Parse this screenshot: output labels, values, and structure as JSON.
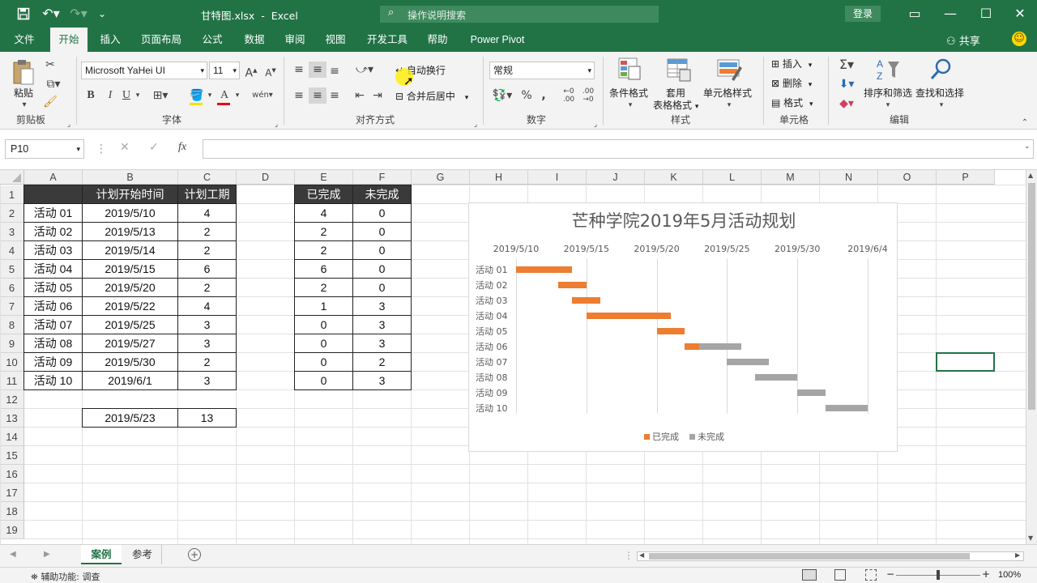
{
  "titlebar": {
    "filename": "甘特图.xlsx",
    "sep": "-",
    "app": "Excel",
    "search_placeholder": "操作说明搜索",
    "login": "登录"
  },
  "tabs": [
    "文件",
    "开始",
    "插入",
    "页面布局",
    "公式",
    "数据",
    "审阅",
    "视图",
    "开发工具",
    "帮助",
    "Power Pivot"
  ],
  "active_tab": "开始",
  "share": "共享",
  "ribbon": {
    "paste": "粘贴",
    "clipboard": "剪贴板",
    "font_name": "Microsoft YaHei UI",
    "font_size": "11",
    "font_group": "字体",
    "bold": "B",
    "italic": "I",
    "underline": "U",
    "wrap_text": "自动换行",
    "merge_center": "合并后居中",
    "align_group": "对齐方式",
    "number_format": "常规",
    "number_group": "数字",
    "cond_format": "条件格式",
    "table_format_1": "套用",
    "table_format_2": "表格格式",
    "cell_styles": "单元格样式",
    "styles_group": "样式",
    "insert": "插入",
    "delete": "删除",
    "format": "格式",
    "cells_group": "单元格",
    "sort_filter": "排序和筛选",
    "find_select": "查找和选择",
    "edit_group": "编辑"
  },
  "formula_bar": {
    "name_box": "P10",
    "fx": "fx",
    "formula": ""
  },
  "columns": [
    "A",
    "B",
    "C",
    "D",
    "E",
    "F",
    "G",
    "H",
    "I",
    "J",
    "K",
    "L",
    "M",
    "N",
    "O",
    "P"
  ],
  "rows": [
    "1",
    "2",
    "3",
    "4",
    "5",
    "6",
    "7",
    "8",
    "9",
    "10",
    "11",
    "12",
    "13",
    "14",
    "15",
    "16",
    "17",
    "18",
    "19"
  ],
  "table": {
    "headers": [
      "",
      "计划开始时间",
      "计划工期"
    ],
    "rows": [
      [
        "活动 01",
        "2019/5/10",
        "4"
      ],
      [
        "活动 02",
        "2019/5/13",
        "2"
      ],
      [
        "活动 03",
        "2019/5/14",
        "2"
      ],
      [
        "活动 04",
        "2019/5/15",
        "6"
      ],
      [
        "活动 05",
        "2019/5/20",
        "2"
      ],
      [
        "活动 06",
        "2019/5/22",
        "4"
      ],
      [
        "活动 07",
        "2019/5/25",
        "3"
      ],
      [
        "活动 08",
        "2019/5/27",
        "3"
      ],
      [
        "活动 09",
        "2019/5/30",
        "2"
      ],
      [
        "活动 10",
        "2019/6/1",
        "3"
      ]
    ],
    "summary": [
      "2019/5/23",
      "13"
    ]
  },
  "table2": {
    "headers": [
      "已完成",
      "未完成"
    ],
    "rows": [
      [
        "4",
        "0"
      ],
      [
        "2",
        "0"
      ],
      [
        "2",
        "0"
      ],
      [
        "6",
        "0"
      ],
      [
        "2",
        "0"
      ],
      [
        "1",
        "3"
      ],
      [
        "0",
        "3"
      ],
      [
        "0",
        "3"
      ],
      [
        "0",
        "2"
      ],
      [
        "0",
        "3"
      ]
    ]
  },
  "chart_data": {
    "type": "bar",
    "title": "芒种学院2019年5月活动规划",
    "categories": [
      "活动 01",
      "活动 02",
      "活动 03",
      "活动 04",
      "活动 05",
      "活动 06",
      "活动 07",
      "活动 08",
      "活动 09",
      "活动 10"
    ],
    "x_ticks": [
      "2019/5/10",
      "2019/5/15",
      "2019/5/20",
      "2019/5/25",
      "2019/5/30",
      "2019/6/4"
    ],
    "xlim": [
      "2019/5/10",
      "2019/6/4"
    ],
    "start": [
      "2019/5/10",
      "2019/5/13",
      "2019/5/14",
      "2019/5/15",
      "2019/5/20",
      "2019/5/22",
      "2019/5/25",
      "2019/5/27",
      "2019/5/30",
      "2019/6/1"
    ],
    "series": [
      {
        "name": "已完成",
        "values": [
          4,
          2,
          2,
          6,
          2,
          1,
          0,
          0,
          0,
          0
        ],
        "color": "#ED7D31"
      },
      {
        "name": "未完成",
        "values": [
          0,
          0,
          0,
          0,
          0,
          3,
          3,
          3,
          2,
          3
        ],
        "color": "#A5A5A5"
      }
    ],
    "legend": "bottom"
  },
  "sheets": [
    "案例",
    "参考"
  ],
  "active_sheet": "案例",
  "status": {
    "accessibility": "辅助功能: 调查",
    "zoom": "100%"
  },
  "colors": {
    "accent": "#217346",
    "done": "#ED7D31",
    "todo": "#A5A5A5",
    "header_fill": "#3A3A3A"
  }
}
